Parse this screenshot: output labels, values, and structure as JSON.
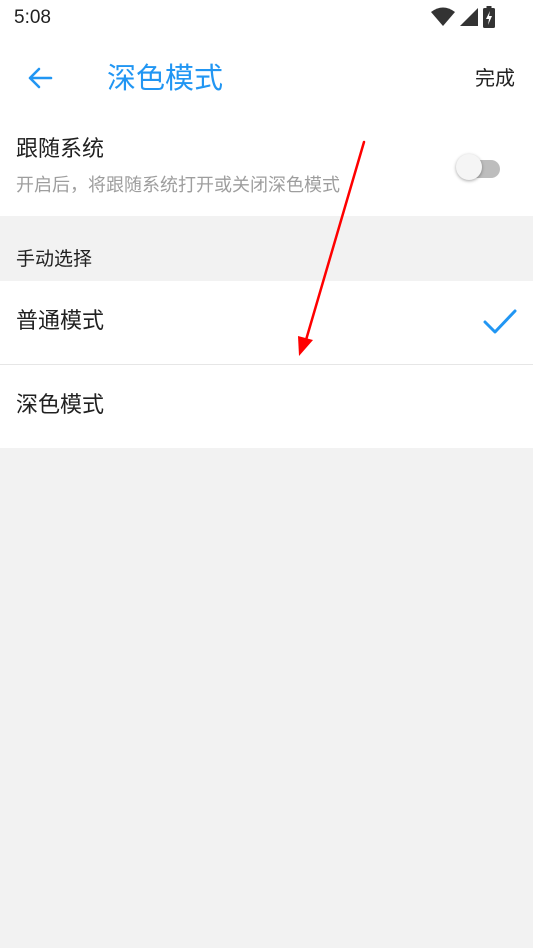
{
  "status_bar": {
    "time": "5:08",
    "icons": [
      "wifi-icon",
      "cellular-signal-icon",
      "battery-charging-icon"
    ]
  },
  "app_bar": {
    "back_icon": "arrow-back-icon",
    "title": "深色模式",
    "done_label": "完成"
  },
  "follow_system": {
    "title": "跟随系统",
    "subtitle": "开启后，将跟随系统打开或关闭深色模式",
    "enabled": false
  },
  "manual": {
    "header": "手动选择",
    "options": [
      {
        "label": "普通模式",
        "selected": true
      },
      {
        "label": "深色模式",
        "selected": false
      }
    ]
  },
  "colors": {
    "accent": "#2196f3",
    "annotation_arrow": "#ff0000",
    "background": "#f2f2f2"
  }
}
